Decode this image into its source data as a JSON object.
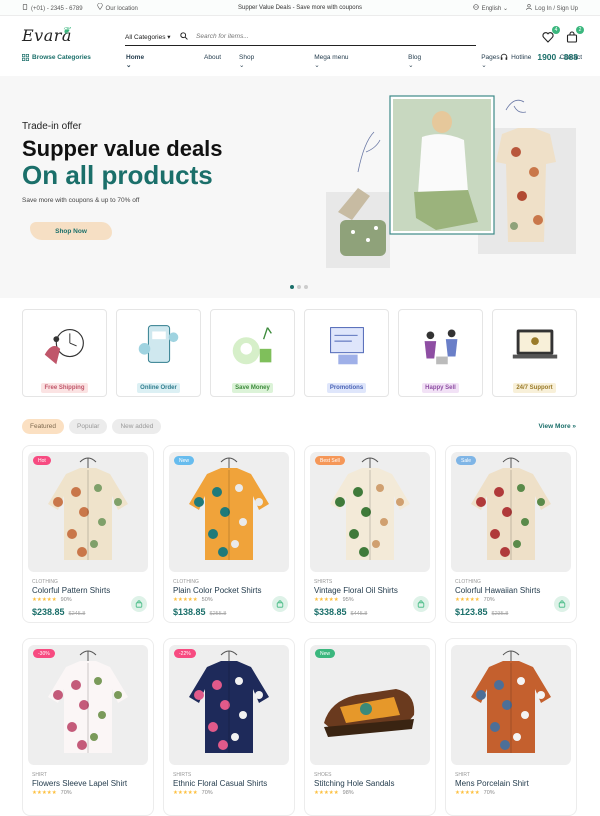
{
  "topbar": {
    "phone": "(+01) - 2345 - 6789",
    "location": "Our location",
    "promo": "Supper Value Deals - Save more with coupons",
    "language": "English",
    "auth": "Log In / Sign Up"
  },
  "header": {
    "logo": "Evara",
    "category_select": "All Categories",
    "search_placeholder": "Search for items...",
    "wishlist_count": "4",
    "cart_count": "2"
  },
  "nav": {
    "browse": "Browse Categories",
    "items": [
      "Home",
      "About",
      "Shop",
      "Mega menu",
      "Blog",
      "Pages",
      "Contact"
    ],
    "hotline_label": "Hotline",
    "hotline_number": "1900 - 888"
  },
  "hero": {
    "subtitle": "Trade-in offer",
    "title_line1": "Supper value deals",
    "title_line2": "On all products",
    "description": "Save more with coupons & up to 70% off",
    "button": "Shop Now"
  },
  "features": [
    {
      "label": "Free Shipping",
      "bg": "#fbe3e3",
      "fg": "#c0566a"
    },
    {
      "label": "Online Order",
      "bg": "#dcf0f4",
      "fg": "#2f7c8d"
    },
    {
      "label": "Save Money",
      "bg": "#dcf3d8",
      "fg": "#3c8a3b"
    },
    {
      "label": "Promotions",
      "bg": "#dfe6fb",
      "fg": "#4a63b5"
    },
    {
      "label": "Happy Sell",
      "bg": "#f2e2f6",
      "fg": "#8e4ea3"
    },
    {
      "label": "24/7 Support",
      "bg": "#f8f0d9",
      "fg": "#9a7b2a"
    }
  ],
  "tabs": [
    "Featured",
    "Popular",
    "New added"
  ],
  "view_more": "View More",
  "products": [
    {
      "tag": "Hot",
      "tag_color": "#f74b81",
      "category": "CLOTHING",
      "name": "Colorful Pattern Shirts",
      "rating": "90%",
      "price": "$238.85",
      "old_price": "$245.8"
    },
    {
      "tag": "New",
      "tag_color": "#67bcee",
      "category": "CLOTHING",
      "name": "Plain Color Pocket Shirts",
      "rating": "50%",
      "price": "$138.85",
      "old_price": "$255.8"
    },
    {
      "tag": "Best Sell",
      "tag_color": "#f59758",
      "category": "SHIRTS",
      "name": "Vintage Floral Oil Shirts",
      "rating": "95%",
      "price": "$338.85",
      "old_price": "$445.8"
    },
    {
      "tag": "Sale",
      "tag_color": "#7fb5e6",
      "category": "CLOTHING",
      "name": "Colorful Hawaiian Shirts",
      "rating": "70%",
      "price": "$123.85",
      "old_price": "$235.8"
    },
    {
      "tag": "-30%",
      "tag_color": "#f74b81",
      "category": "SHIRT",
      "name": "Flowers Sleeve Lapel Shirt",
      "rating": "70%",
      "price": "",
      "old_price": ""
    },
    {
      "tag": "-22%",
      "tag_color": "#f74b81",
      "category": "SHIRTS",
      "name": "Ethnic Floral Casual Shirts",
      "rating": "70%",
      "price": "",
      "old_price": ""
    },
    {
      "tag": "New",
      "tag_color": "#3bb77e",
      "category": "SHOES",
      "name": "Stitching Hole Sandals",
      "rating": "98%",
      "price": "",
      "old_price": ""
    },
    {
      "tag": "",
      "tag_color": "",
      "category": "SHIRT",
      "name": "Mens Porcelain Shirt",
      "rating": "70%",
      "price": "",
      "old_price": ""
    }
  ]
}
